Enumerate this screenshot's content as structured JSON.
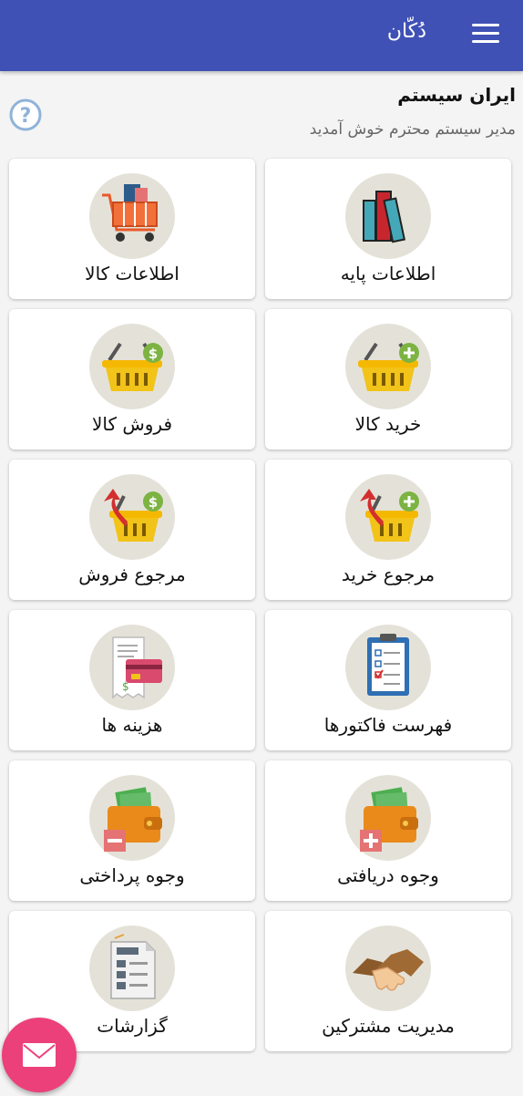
{
  "app": {
    "title": "دُکّان"
  },
  "header": {
    "company": "ایران سیستم",
    "welcome": "مدیر سیستم محترم خوش آمدید"
  },
  "menu": [
    {
      "label": "اطلاعات پایه",
      "icon": "books-icon"
    },
    {
      "label": "اطلاعات کالا",
      "icon": "shopping-cart-icon"
    },
    {
      "label": "خرید کالا",
      "icon": "basket-plus-icon"
    },
    {
      "label": "فروش کالا",
      "icon": "basket-dollar-icon"
    },
    {
      "label": "مرجوع خرید",
      "icon": "basket-return-plus-icon"
    },
    {
      "label": "مرجوع فروش",
      "icon": "basket-return-dollar-icon"
    },
    {
      "label": "فهرست فاکتورها",
      "icon": "clipboard-checklist-icon"
    },
    {
      "label": "هزینه ها",
      "icon": "receipt-card-icon"
    },
    {
      "label": "وجوه دریافتی",
      "icon": "wallet-plus-icon"
    },
    {
      "label": "وجوه پرداختی",
      "icon": "wallet-minus-icon"
    },
    {
      "label": "مدیریت مشترکین",
      "icon": "handshake-icon"
    },
    {
      "label": "گزارشات",
      "icon": "report-document-icon"
    }
  ],
  "colors": {
    "appbar": "#3f51b5",
    "fab": "#ec407a",
    "icon_bg": "#e4e2d8"
  }
}
